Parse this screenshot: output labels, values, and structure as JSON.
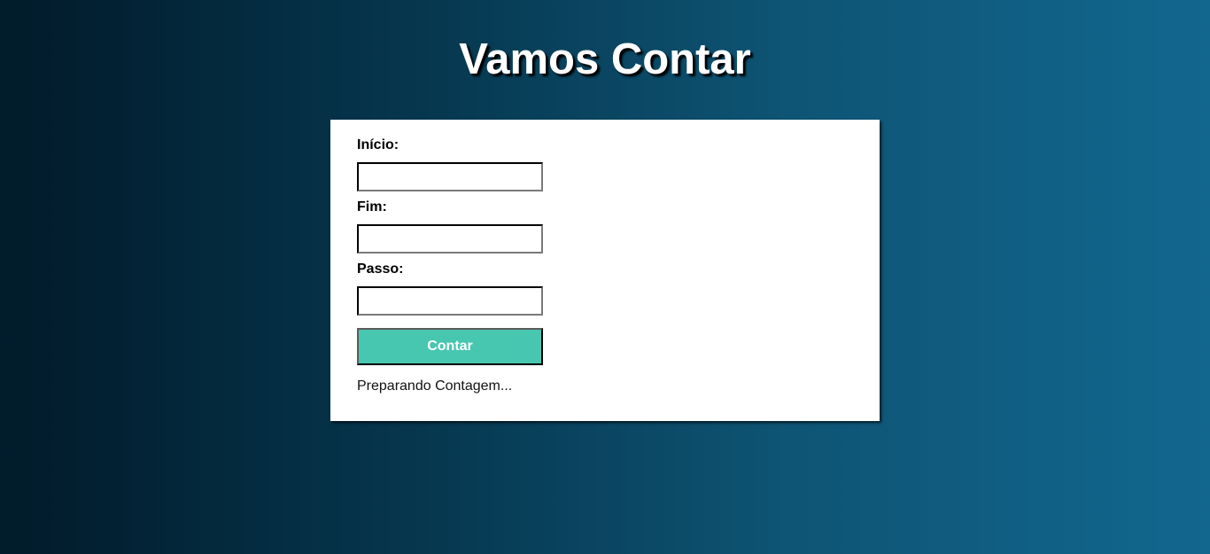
{
  "header": {
    "title": "Vamos Contar"
  },
  "form": {
    "start_label": "Início:",
    "start_value": "",
    "end_label": "Fim:",
    "end_value": "",
    "step_label": "Passo:",
    "step_value": "",
    "button_label": "Contar"
  },
  "result": {
    "status": "Preparando Contagem..."
  },
  "colors": {
    "button": "#47c6b0",
    "background_dark": "#011c2b",
    "background_light": "#12678f",
    "card": "#ffffff"
  }
}
